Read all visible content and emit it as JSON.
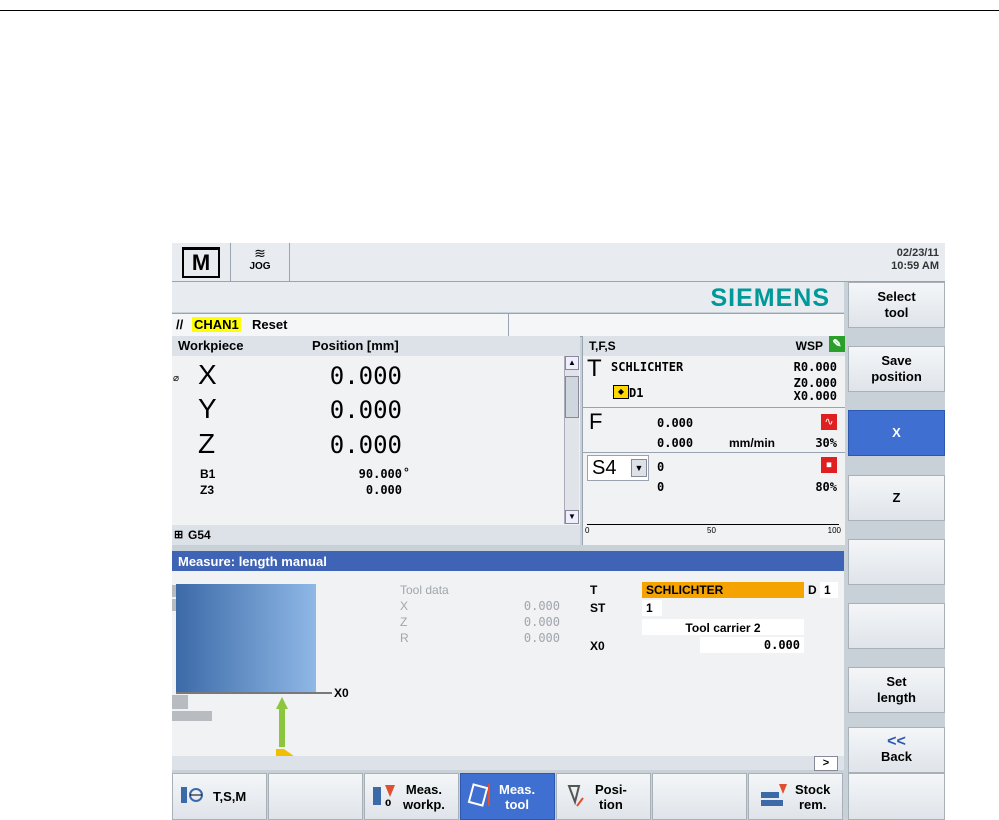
{
  "header": {
    "mode_glyph": "M",
    "jog_label": "JOG",
    "date": "02/23/11",
    "time": "10:59 AM"
  },
  "brand": "SIEMENS",
  "channel": {
    "name": "CHAN1",
    "state": "Reset"
  },
  "workpiece": {
    "col_workpiece": "Workpiece",
    "col_position": "Position [mm]",
    "diameter_mark": "⌀",
    "axes": [
      {
        "name": "X",
        "value": "0.000"
      },
      {
        "name": "Y",
        "value": "0.000"
      },
      {
        "name": "Z",
        "value": "0.000"
      }
    ],
    "small_axes": [
      {
        "name": "B1",
        "value": "90.000",
        "unit": "°"
      },
      {
        "name": "Z3",
        "value": "0.000",
        "unit": ""
      }
    ],
    "frame": "G54"
  },
  "tfs": {
    "title": "T,F,S",
    "wsp": "WSP",
    "tool_letter": "T",
    "tool_name": "SCHLICHTER",
    "tool_r": "R0.000",
    "tool_z": "Z0.000",
    "tool_x": "X0.000",
    "tool_d": "D1",
    "f_letter": "F",
    "f_val1": "0.000",
    "f_val2": "0.000",
    "f_unit": "mm/min",
    "f_override": "30%",
    "s_label": "S4",
    "s_val1": "0",
    "s_val2": "0",
    "s_override": "80%",
    "scale_0": "0",
    "scale_50": "50",
    "scale_100": "100",
    "spindle_load_fraction": 0.0
  },
  "measure": {
    "title": "Measure: length manual",
    "tool_data_label": "Tool data",
    "rows": [
      {
        "name": "X",
        "value": "0.000"
      },
      {
        "name": "Z",
        "value": "0.000"
      },
      {
        "name": "R",
        "value": "0.000"
      }
    ],
    "t_label": "T",
    "t_value": "SCHLICHTER",
    "d_label": "D",
    "d_value": "1",
    "st_label": "ST",
    "st_value": "1",
    "carrier": "Tool carrier 2",
    "x0_label": "X0",
    "x0_value": "0.000",
    "graphic_x0": "X0",
    "scroll_arrow": ">"
  },
  "softkeys_right": [
    {
      "line1": "Select",
      "line2": "tool"
    },
    {
      "line1": "Save",
      "line2": "position"
    },
    {
      "line1": "X",
      "line2": ""
    },
    {
      "line1": "Z",
      "line2": ""
    },
    {
      "line1": "",
      "line2": ""
    },
    {
      "line1": "",
      "line2": ""
    },
    {
      "line1": "Set",
      "line2": "length"
    },
    {
      "line1": "<<",
      "line2": "Back"
    }
  ],
  "softkeys_bottom": [
    {
      "line1": "T,S,M",
      "line2": ""
    },
    {
      "line1": "",
      "line2": ""
    },
    {
      "line1": "Meas.",
      "line2": "workp."
    },
    {
      "line1": "Meas.",
      "line2": "tool"
    },
    {
      "line1": "Posi-",
      "line2": "tion"
    },
    {
      "line1": "",
      "line2": ""
    },
    {
      "line1": "Stock",
      "line2": "rem."
    },
    {
      "line1": "",
      "line2": ""
    }
  ],
  "colors": {
    "active": "#3f6fd0",
    "title_bar": "#3f63b5",
    "brand": "#009999",
    "highlight": "#ffff00",
    "tool_field": "#f5a300"
  }
}
